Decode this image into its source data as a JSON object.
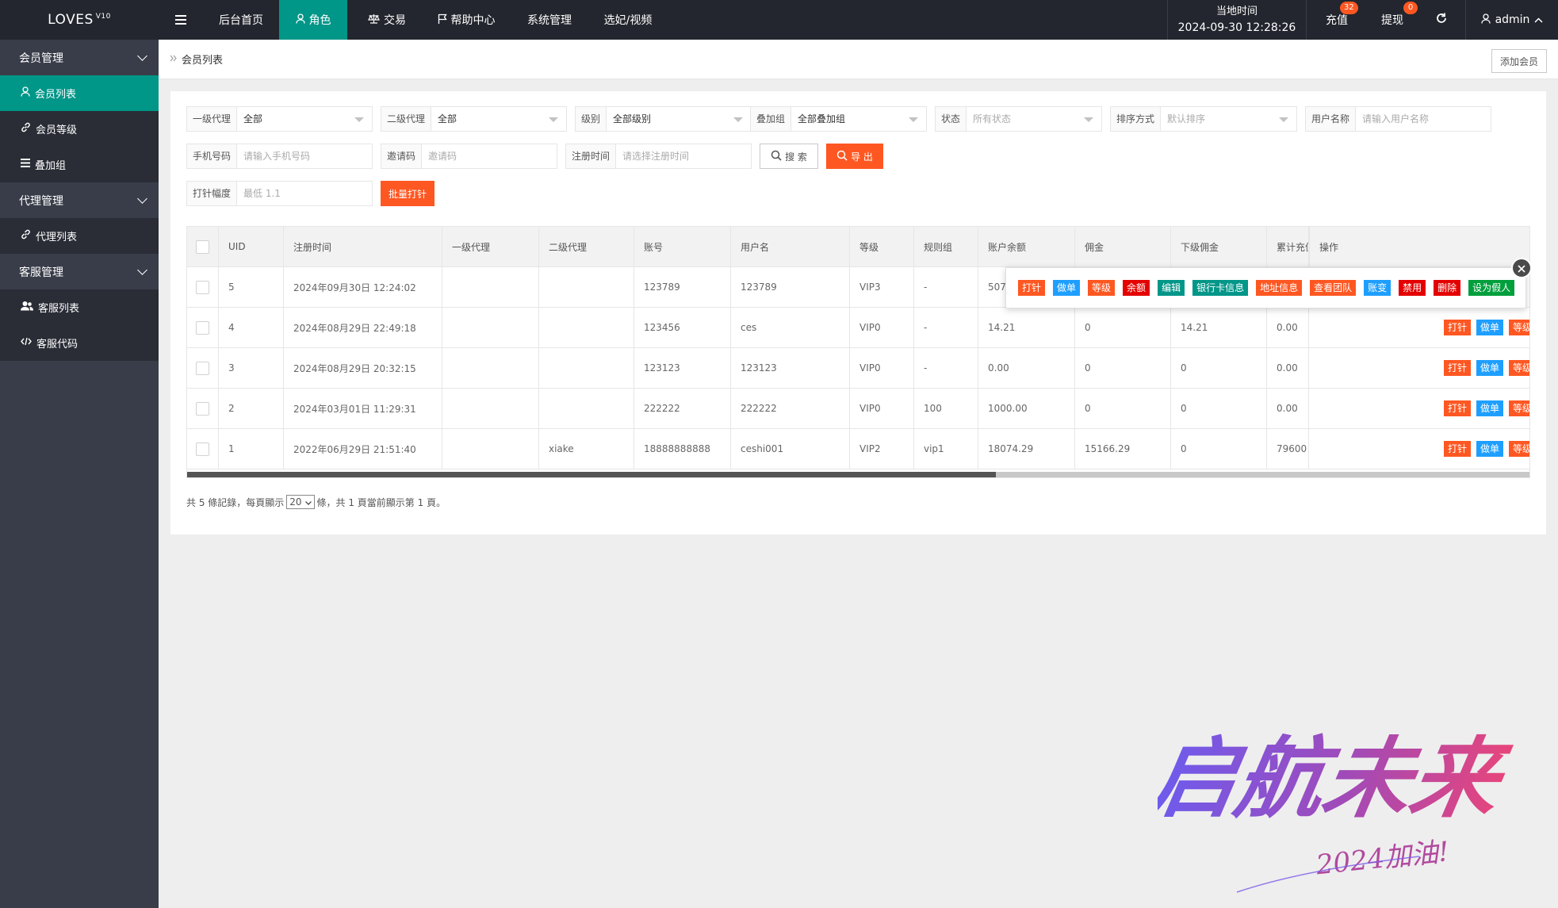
{
  "topbar": {
    "logo": "LOVES",
    "logo_version": "V10",
    "nav": [
      {
        "label": "后台首页",
        "active": false
      },
      {
        "label": "角色",
        "active": true
      },
      {
        "label": "交易",
        "active": false
      },
      {
        "label": "帮助中心",
        "active": false
      },
      {
        "label": "系统管理",
        "active": false
      },
      {
        "label": "选妃/视频",
        "active": false
      }
    ],
    "time_label": "当地时间",
    "time_value": "2024-09-30 12:28:26",
    "recharge": {
      "label": "充值",
      "badge": "32"
    },
    "withdraw": {
      "label": "提现",
      "badge": "0"
    },
    "user": "admin"
  },
  "sidebar": {
    "groups": [
      {
        "label": "会员管理",
        "items": [
          {
            "label": "会员列表",
            "icon": "user-icon",
            "active": true
          },
          {
            "label": "会员等级",
            "icon": "link-icon",
            "active": false
          },
          {
            "label": "叠加组",
            "icon": "list-icon",
            "active": false
          }
        ]
      },
      {
        "label": "代理管理",
        "items": [
          {
            "label": "代理列表",
            "icon": "link-icon",
            "active": false
          }
        ]
      },
      {
        "label": "客服管理",
        "items": [
          {
            "label": "客服列表",
            "icon": "users-icon",
            "active": false
          },
          {
            "label": "客服代码",
            "icon": "code-icon",
            "active": false
          }
        ]
      }
    ]
  },
  "breadcrumb": {
    "current": "会员列表",
    "add_button": "添加会员"
  },
  "filters": {
    "agent1": {
      "label": "一级代理",
      "value": "全部"
    },
    "agent2": {
      "label": "二级代理",
      "value": "全部"
    },
    "level": {
      "label": "级别",
      "value": "全部级别"
    },
    "stack": {
      "label": "叠加组",
      "value": "全部叠加组"
    },
    "status": {
      "label": "状态",
      "placeholder": "所有状态"
    },
    "sort": {
      "label": "排序方式",
      "placeholder": "默认排序"
    },
    "username": {
      "label": "用户名称",
      "placeholder": "请输入用户名称"
    },
    "phone": {
      "label": "手机号码",
      "placeholder": "请输入手机号码"
    },
    "invite": {
      "label": "邀请码",
      "placeholder": "邀请码"
    },
    "regtime": {
      "label": "注册时间",
      "placeholder": "请选择注册时间"
    },
    "search_button": "搜 索",
    "export_button": "导 出",
    "amplitude": {
      "label": "打针幅度",
      "placeholder": "最低 1.1"
    },
    "batch_button": "批量打针"
  },
  "table": {
    "headers": [
      "UID",
      "注册时间",
      "一级代理",
      "二级代理",
      "账号",
      "用户名",
      "等级",
      "规则组",
      "账户余额",
      "佣金",
      "下级佣金",
      "累计充值",
      "操作"
    ],
    "rows": [
      {
        "uid": "5",
        "regtime": "2024年09月30日 12:24:02",
        "agent1": "",
        "agent2": "",
        "account": "123789",
        "username": "123789",
        "level": "VIP3",
        "rule": "-",
        "balance": "507",
        "commission": "",
        "sub_commission": "",
        "recharge": ""
      },
      {
        "uid": "4",
        "regtime": "2024年08月29日 22:49:18",
        "agent1": "",
        "agent2": "",
        "account": "123456",
        "username": "ces",
        "level": "VIP0",
        "rule": "-",
        "balance": "14.21",
        "commission": "0",
        "sub_commission": "14.21",
        "recharge": "0.00"
      },
      {
        "uid": "3",
        "regtime": "2024年08月29日 20:32:15",
        "agent1": "",
        "agent2": "",
        "account": "123123",
        "username": "123123",
        "level": "VIP0",
        "rule": "-",
        "balance": "0.00",
        "commission": "0",
        "sub_commission": "0",
        "recharge": "0.00"
      },
      {
        "uid": "2",
        "regtime": "2024年03月01日 11:29:31",
        "agent1": "",
        "agent2": "",
        "account": "222222",
        "username": "222222",
        "level": "VIP0",
        "rule": "100",
        "balance": "1000.00",
        "commission": "0",
        "sub_commission": "0",
        "recharge": "0.00"
      },
      {
        "uid": "1",
        "regtime": "2022年06月29日 21:51:40",
        "agent1": "",
        "agent2": "xiake",
        "account": "18888888888",
        "username": "ceshi001",
        "level": "VIP2",
        "rule": "vip1",
        "balance": "18074.29",
        "commission": "15166.29",
        "sub_commission": "0",
        "recharge": "79600"
      }
    ],
    "row_ops": [
      "打针",
      "做单",
      "等级",
      "余额",
      "编辑"
    ],
    "more": "..."
  },
  "popover_ops": [
    "打针",
    "做单",
    "等级",
    "余额",
    "编辑",
    "银行卡信息",
    "地址信息",
    "查看团队",
    "账变",
    "禁用",
    "删除",
    "设为假人"
  ],
  "pager": {
    "prefix": "共 5 條記錄，每頁顯示",
    "page_size": "20",
    "suffix": "條，共 1 頁當前顯示第 1 頁。"
  },
  "watermark": {
    "main": "启航未来",
    "sub": "2024加油!"
  },
  "colors": {
    "accent": "#009688",
    "orange": "#ff5722",
    "blue": "#1e9fff",
    "red": "#e40000",
    "green": "#009f3c",
    "dark": "#23262e",
    "sidebar": "#393d49"
  }
}
